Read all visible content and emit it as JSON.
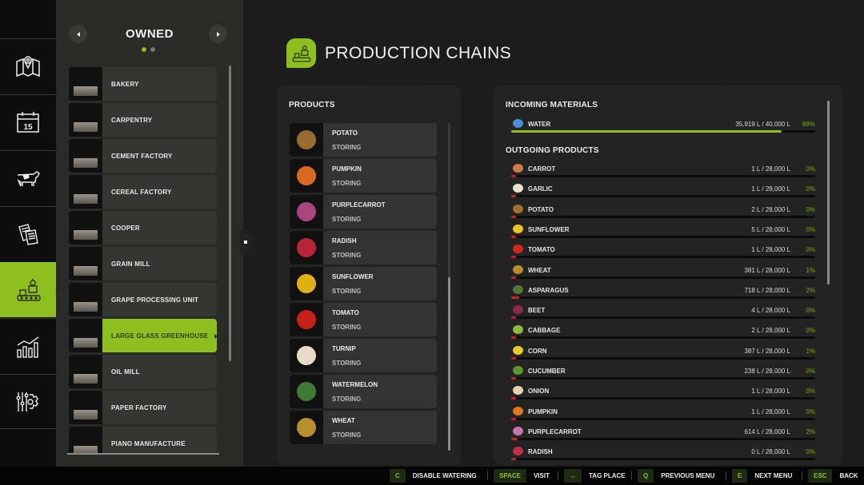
{
  "rail": {
    "items": [
      {
        "id": "map",
        "icon": "map-pin-icon",
        "active": false
      },
      {
        "id": "calendar",
        "icon": "calendar-icon",
        "label": "15",
        "active": false
      },
      {
        "id": "animals",
        "icon": "cow-icon",
        "active": false
      },
      {
        "id": "contracts",
        "icon": "documents-icon",
        "active": false
      },
      {
        "id": "production",
        "icon": "production-robot-icon",
        "active": true
      },
      {
        "id": "statistics",
        "icon": "chart-bars-icon",
        "active": false
      },
      {
        "id": "settings",
        "icon": "settings-sliders-gear-icon",
        "active": false
      }
    ]
  },
  "owned": {
    "title": "OWNED",
    "page_dots": 2,
    "current_page": 1,
    "places": [
      {
        "label": "BAKERY",
        "active": false
      },
      {
        "label": "CARPENTRY",
        "active": false
      },
      {
        "label": "CEMENT FACTORY",
        "active": false
      },
      {
        "label": "CEREAL FACTORY",
        "active": false
      },
      {
        "label": "COOPER",
        "active": false
      },
      {
        "label": "GRAIN MILL",
        "active": false
      },
      {
        "label": "GRAPE PROCESSING UNIT",
        "active": false
      },
      {
        "label": "LARGE GLASS GREENHOUSE",
        "active": true
      },
      {
        "label": "OIL MILL",
        "active": false
      },
      {
        "label": "PAPER FACTORY",
        "active": false
      },
      {
        "label": "PIANO MANUFACTURE",
        "active": false
      }
    ]
  },
  "header": {
    "title": "PRODUCTION CHAINS",
    "icon": "production-robot-icon"
  },
  "products": {
    "title": "PRODUCTS",
    "items": [
      {
        "name": "POTATO",
        "status": "STORING",
        "color": "#9b6a2f"
      },
      {
        "name": "PUMPKIN",
        "status": "STORING",
        "color": "#d9691e"
      },
      {
        "name": "PURPLECARROT",
        "status": "STORING",
        "color": "#a8457e"
      },
      {
        "name": "RADISH",
        "status": "STORING",
        "color": "#b8243a"
      },
      {
        "name": "SUNFLOWER",
        "status": "STORING",
        "color": "#e0b012"
      },
      {
        "name": "TOMATO",
        "status": "STORING",
        "color": "#c8201b"
      },
      {
        "name": "TURNIP",
        "status": "STORING",
        "color": "#e9d9c8"
      },
      {
        "name": "WATERMELON",
        "status": "STORING",
        "color": "#3f7a35"
      },
      {
        "name": "WHEAT",
        "status": "STORING",
        "color": "#b88f2a"
      }
    ]
  },
  "materials": {
    "incoming_title": "INCOMING MATERIALS",
    "incoming": [
      {
        "name": "WATER",
        "amount": "35,919 L / 40,000 L",
        "percent": "89%",
        "fill": 0.89,
        "color": "#4b8fd8"
      }
    ],
    "outgoing_title": "OUTGOING PRODUCTS",
    "outgoing": [
      {
        "name": "CARROT",
        "amount": "1 L / 28,000 L",
        "percent": "0%",
        "fill": 0.0,
        "color": "#c97b4a"
      },
      {
        "name": "GARLIC",
        "amount": "1 L / 28,000 L",
        "percent": "0%",
        "fill": 0.0,
        "color": "#e8e2d2"
      },
      {
        "name": "POTATO",
        "amount": "2 L / 28,000 L",
        "percent": "0%",
        "fill": 0.0,
        "color": "#a0702f"
      },
      {
        "name": "SUNFLOWER",
        "amount": "5 L / 28,000 L",
        "percent": "0%",
        "fill": 0.0,
        "color": "#e6c51a"
      },
      {
        "name": "TOMATO",
        "amount": "1 L / 28,000 L",
        "percent": "0%",
        "fill": 0.0,
        "color": "#d3271f"
      },
      {
        "name": "WHEAT",
        "amount": "381 L / 28,000 L",
        "percent": "1%",
        "fill": 0.014,
        "color": "#b88f2a"
      },
      {
        "name": "ASPARAGUS",
        "amount": "718 L / 28,000 L",
        "percent": "2%",
        "fill": 0.026,
        "color": "#4c7a3b"
      },
      {
        "name": "BEET",
        "amount": "4 L / 28,000 L",
        "percent": "0%",
        "fill": 0.0,
        "color": "#8a2a4a"
      },
      {
        "name": "CABBAGE",
        "amount": "2 L / 28,000 L",
        "percent": "0%",
        "fill": 0.0,
        "color": "#8dbb3a"
      },
      {
        "name": "CORN",
        "amount": "387 L / 28,000 L",
        "percent": "1%",
        "fill": 0.014,
        "color": "#e9c82a"
      },
      {
        "name": "CUCUMBER",
        "amount": "238 L / 28,000 L",
        "percent": "0%",
        "fill": 0.008,
        "color": "#5a9a2e"
      },
      {
        "name": "ONION",
        "amount": "1 L / 28,000 L",
        "percent": "0%",
        "fill": 0.0,
        "color": "#e6d4a8"
      },
      {
        "name": "PUMPKIN",
        "amount": "1 L / 28,000 L",
        "percent": "0%",
        "fill": 0.0,
        "color": "#e0791e"
      },
      {
        "name": "PURPLECARROT",
        "amount": "614 L / 28,000 L",
        "percent": "2%",
        "fill": 0.022,
        "color": "#c07aa8"
      },
      {
        "name": "RADISH",
        "amount": "0 L / 28,000 L",
        "percent": "0%",
        "fill": 0.0,
        "color": "#c0304a"
      }
    ]
  },
  "colors": {
    "accent": "#8fbf1e",
    "bar_low": "#cc1f1f",
    "percent_text": "#7ea61c"
  },
  "helpbar": {
    "items": [
      {
        "key": "C",
        "action": "DISABLE WATERING"
      },
      {
        "key": "SPACE",
        "action": "VISIT"
      },
      {
        "key": "↔",
        "action": "TAG PLACE"
      },
      {
        "key": "Q",
        "action": "PREVIOUS MENU"
      },
      {
        "key": "E",
        "action": "NEXT MENU"
      },
      {
        "key": "ESC",
        "action": "BACK"
      }
    ]
  }
}
